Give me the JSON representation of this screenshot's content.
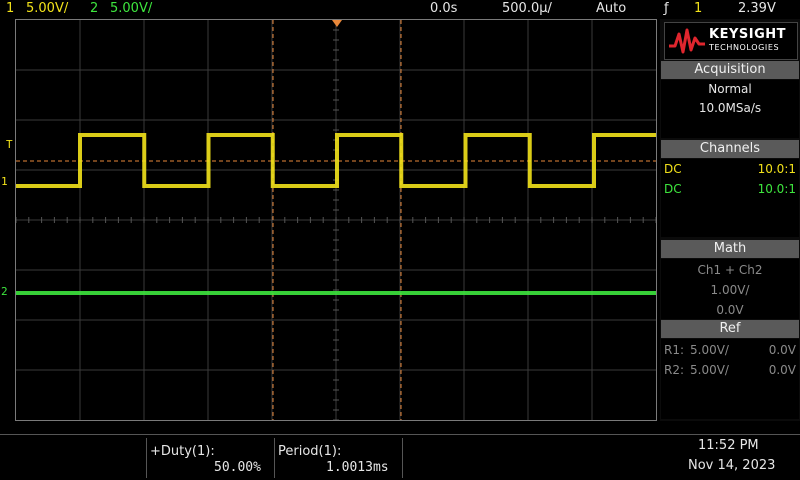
{
  "topbar": {
    "ch1_num": "1",
    "ch1_scale": "5.00V/",
    "ch2_num": "2",
    "ch2_scale": "5.00V/",
    "time_offset": "0.0s",
    "time_scale": "500.0µ/",
    "trigger_mode": "Auto",
    "trigger_slope_symbol": "ƒ",
    "trigger_source": "1",
    "trigger_level": "2.39V"
  },
  "screen": {
    "trigger_marker": "T",
    "ch1_marker": "1",
    "ch2_marker": "2"
  },
  "brand": {
    "name": "KEYSIGHT",
    "sub": "TECHNOLOGIES"
  },
  "acquisition": {
    "title": "Acquisition",
    "mode": "Normal",
    "rate": "10.0MSa/s"
  },
  "channels": {
    "title": "Channels",
    "rows": [
      {
        "coupling": "DC",
        "probe": "10.0:1"
      },
      {
        "coupling": "DC",
        "probe": "10.0:1"
      }
    ]
  },
  "math": {
    "title": "Math",
    "expr": "Ch1 + Ch2",
    "scale": "1.00V/",
    "offset": "0.0V"
  },
  "ref": {
    "title": "Ref",
    "rows": [
      {
        "name": "R1:",
        "scale": "5.00V/",
        "offset": "0.0V"
      },
      {
        "name": "R2:",
        "scale": "5.00V/",
        "offset": "0.0V"
      }
    ]
  },
  "measurements": {
    "duty_label": "+Duty(1):",
    "duty_value": "50.00%",
    "period_label": "Period(1):",
    "period_value": "1.0013ms"
  },
  "clock": {
    "time": "11:52 PM",
    "date": "Nov 14, 2023"
  },
  "colors": {
    "ch1": "#f2e21a",
    "ch2": "#3ee63e",
    "cursor": "#e8873a",
    "panel_header": "#5a5a5a"
  }
}
